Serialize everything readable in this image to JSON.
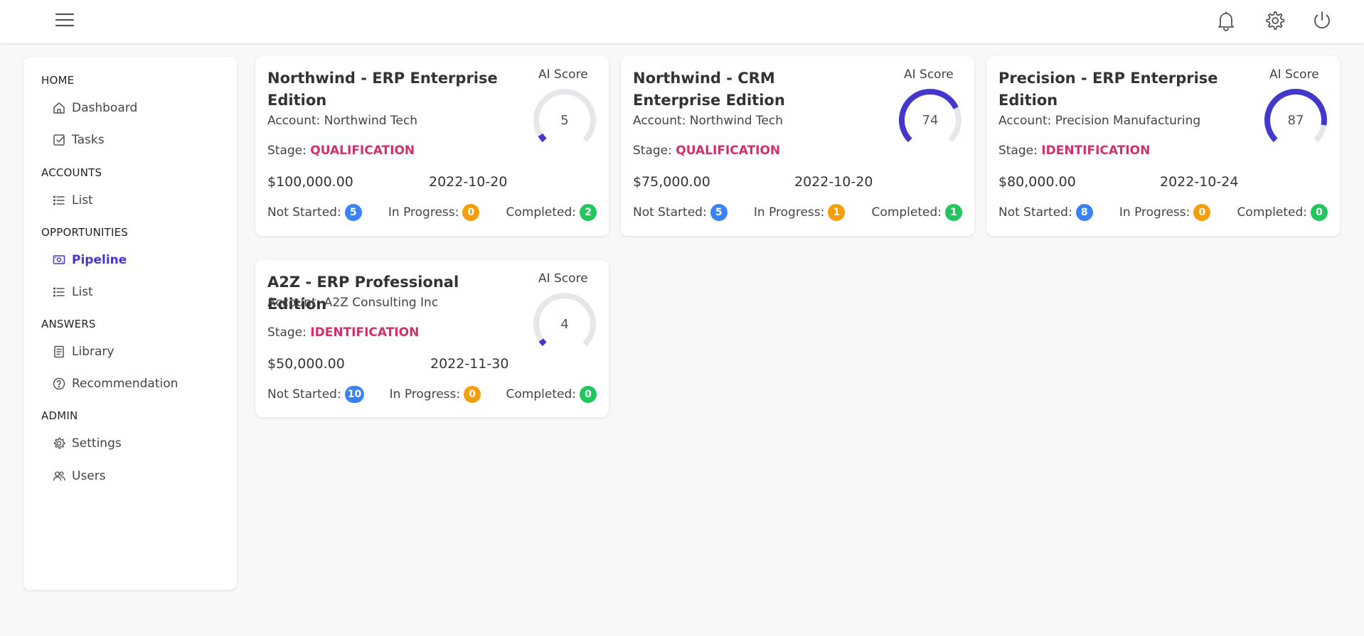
{
  "header": {
    "menu_icon": "hamburger-menu-icon",
    "icons": [
      "bell-icon",
      "gear-icon",
      "power-icon"
    ]
  },
  "sidebar": {
    "sections": [
      {
        "label": "HOME",
        "items": [
          {
            "label": "Dashboard",
            "icon": "home-icon"
          },
          {
            "label": "Tasks",
            "icon": "checkbox-icon"
          }
        ]
      },
      {
        "label": "ACCOUNTS",
        "items": [
          {
            "label": "List",
            "icon": "list-icon"
          }
        ]
      },
      {
        "label": "OPPORTUNITIES",
        "items": [
          {
            "label": "Pipeline",
            "icon": "pipeline-icon",
            "active": true
          },
          {
            "label": "List",
            "icon": "list-icon"
          }
        ]
      },
      {
        "label": "ANSWERS",
        "items": [
          {
            "label": "Library",
            "icon": "book-icon"
          },
          {
            "label": "Recommendation",
            "icon": "question-circle-icon"
          }
        ]
      },
      {
        "label": "ADMIN",
        "items": [
          {
            "label": "Settings",
            "icon": "gear-icon"
          },
          {
            "label": "Users",
            "icon": "users-icon"
          }
        ]
      }
    ]
  },
  "cards": [
    {
      "title": "Northwind - ERP Enterprise Edition",
      "account_label": "Account:",
      "account": "Northwind Tech",
      "stage_label": "Stage:",
      "stage": "QUALIFICATION",
      "amount": "$100,000.00",
      "date": "2022-10-20",
      "ai_label": "AI Score",
      "ai_score": 5,
      "not_started_label": "Not Started:",
      "not_started": "5",
      "in_progress_label": "In Progress:",
      "in_progress": "0",
      "completed_label": "Completed:",
      "completed": "2"
    },
    {
      "title": "Northwind - CRM Enterprise Edition",
      "account_label": "Account:",
      "account": "Northwind Tech",
      "stage_label": "Stage:",
      "stage": "QUALIFICATION",
      "amount": "$75,000.00",
      "date": "2022-10-20",
      "ai_label": "AI Score",
      "ai_score": 74,
      "not_started_label": "Not Started:",
      "not_started": "5",
      "in_progress_label": "In Progress:",
      "in_progress": "1",
      "completed_label": "Completed:",
      "completed": "1"
    },
    {
      "title": "Precision - ERP Enterprise Edition",
      "account_label": "Account:",
      "account": "Precision Manufacturing",
      "stage_label": "Stage:",
      "stage": "IDENTIFICATION",
      "amount": "$80,000.00",
      "date": "2022-10-24",
      "ai_label": "AI Score",
      "ai_score": 87,
      "not_started_label": "Not Started:",
      "not_started": "8",
      "in_progress_label": "In Progress:",
      "in_progress": "0",
      "completed_label": "Completed:",
      "completed": "0"
    },
    {
      "title": "A2Z - ERP Professional Edition",
      "account_label": "Account:",
      "account": "A2Z Consulting Inc",
      "stage_label": "Stage:",
      "stage": "IDENTIFICATION",
      "amount": "$50,000.00",
      "date": "2022-11-30",
      "ai_label": "AI Score",
      "ai_score": 4,
      "not_started_label": "Not Started:",
      "not_started": "10",
      "in_progress_label": "In Progress:",
      "in_progress": "0",
      "completed_label": "Completed:",
      "completed": "0"
    }
  ],
  "colors": {
    "accent": "#4338ca",
    "stage": "#d0306d",
    "gauge_track": "#e5e7eb",
    "badge_blue": "#3b82f6",
    "badge_orange": "#f59e0b",
    "badge_green": "#22c55e"
  }
}
